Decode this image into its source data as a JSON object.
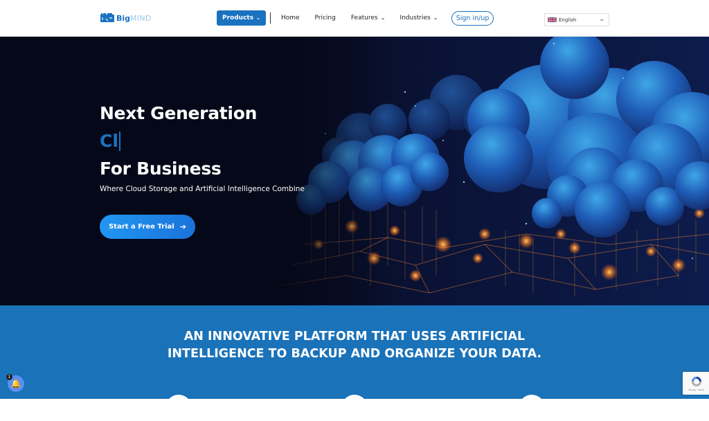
{
  "header": {
    "logo": {
      "big": "Big",
      "mind": "MIND"
    },
    "nav": {
      "products": "Products",
      "home": "Home",
      "pricing": "Pricing",
      "features": "Features",
      "industries": "Industries",
      "signin": "Sign in/up"
    },
    "language": {
      "selected": "English"
    }
  },
  "hero": {
    "title_line1": "Next Generation",
    "typed_text": "Cl",
    "title_line2": "For Business",
    "subtitle": "Where Cloud Storage and Artificial Intelligence Combine",
    "cta_label": "Start a Free Trial",
    "cta_icon": "arrow-right-icon"
  },
  "section": {
    "title_line1": "AN INNOVATIVE PLATFORM THAT USES ARTIFICIAL",
    "title_line2": "INTELLIGENCE TO BACKUP AND ORGANIZE YOUR DATA."
  },
  "widgets": {
    "notification_count": "1",
    "recaptcha_text": "Privacy - Terms"
  },
  "colors": {
    "brand_blue": "#1a72c0",
    "section_blue": "#1a72b9",
    "cta_blue": "#2196f3",
    "hero_dark": "#050818"
  }
}
